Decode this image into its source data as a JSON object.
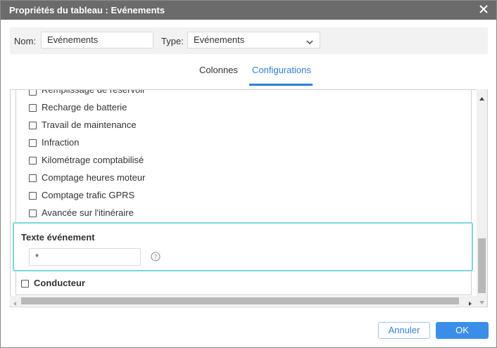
{
  "dialog": {
    "title": "Propriétés du tableau : Evénements",
    "close_icon": "close-icon"
  },
  "header": {
    "name_label": "Nom:",
    "name_value": "Evénements",
    "type_label": "Type:",
    "type_value": "Evénements"
  },
  "tabs": [
    {
      "label": "Colonnes",
      "active": false
    },
    {
      "label": "Configurations",
      "active": true
    }
  ],
  "list": {
    "items": [
      {
        "label": "Remplissage de réservoir",
        "checked": false
      },
      {
        "label": "Recharge de batterie",
        "checked": false
      },
      {
        "label": "Travail de maintenance",
        "checked": false
      },
      {
        "label": "Infraction",
        "checked": false
      },
      {
        "label": "Kilométrage comptabilisé",
        "checked": false
      },
      {
        "label": "Comptage heures moteur",
        "checked": false
      },
      {
        "label": "Comptage trafic GPRS",
        "checked": false
      },
      {
        "label": "Avancée sur l'itinéraire",
        "checked": false
      }
    ]
  },
  "event_text": {
    "title": "Texte événement",
    "value": "*",
    "help_icon": "help-icon"
  },
  "driver": {
    "label": "Conducteur",
    "checked": false
  },
  "footer": {
    "cancel_label": "Annuler",
    "ok_label": "OK"
  },
  "colors": {
    "titlebar": "#6b6b6b",
    "accent": "#2f7fd8",
    "ok_button": "#3a8ee8",
    "highlight_border": "#7fd4e0"
  }
}
